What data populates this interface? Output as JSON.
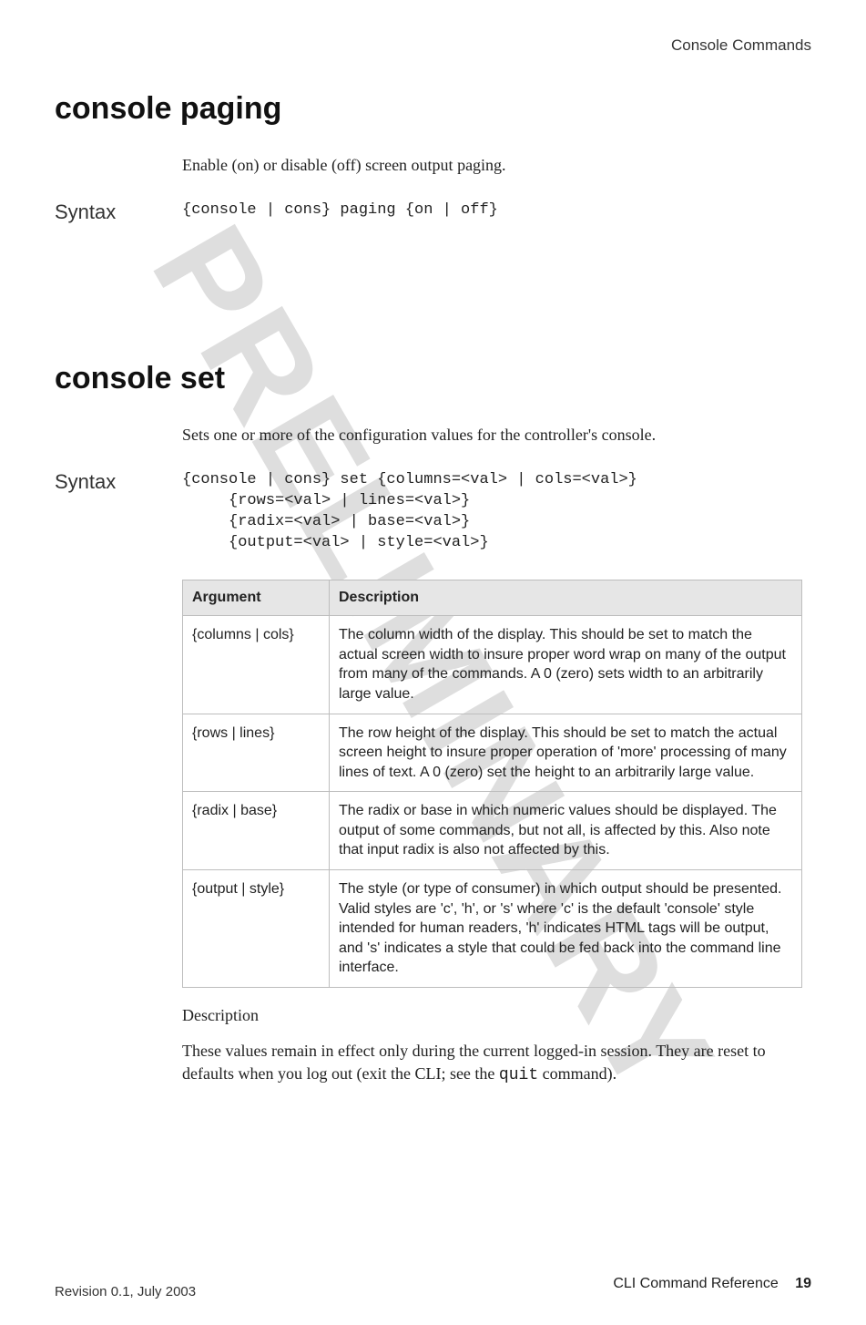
{
  "watermark": "PRELIMINARY",
  "header": {
    "section": "Console Commands"
  },
  "commands": [
    {
      "title": "console paging",
      "intro": "Enable (on) or disable (off) screen output paging.",
      "syntax_label": "Syntax",
      "syntax": "{console | cons} paging {on | off}"
    },
    {
      "title": "console set",
      "intro": "Sets one or more of the configuration values for the controller's console.",
      "syntax_label": "Syntax",
      "syntax": "{console | cons} set {columns=<val> | cols=<val>}\n     {rows=<val> | lines=<val>}\n     {radix=<val> | base=<val>}\n     {output=<val> | style=<val>}",
      "table": {
        "headers": {
          "arg": "Argument",
          "desc": "Description"
        },
        "rows": [
          {
            "arg": "{columns | cols}",
            "desc": "The column width of the display. This should be set to match the actual screen width to insure proper word wrap on many of the output from many of the commands. A 0 (zero) sets width to an arbitrarily large value."
          },
          {
            "arg": "{rows | lines}",
            "desc": "The row height of the display. This should be set to match the actual screen height to insure proper operation of 'more' processing of many lines of text. A 0 (zero) set the height to an arbitrarily large value."
          },
          {
            "arg": "{radix | base}",
            "desc": "The radix or base in which numeric values should be displayed. The output of some commands, but not all, is affected by this. Also note that input radix is also not affected by this."
          },
          {
            "arg": "{output | style}",
            "desc": "The style (or type of consumer) in which output should be presented. Valid styles are 'c', 'h', or 's' where 'c' is the default 'console' style intended for human readers, 'h' indicates HTML tags will be output, and 's' indicates a style that could be fed back into the command line interface."
          }
        ]
      },
      "post": {
        "head": "Description",
        "body_pre": "These values remain in effect only during the current logged-in session. They are reset to defaults when you log out (exit the CLI; see the ",
        "body_mono": "quit",
        "body_post": " command)."
      }
    }
  ],
  "footer": {
    "left": "Revision 0.1, July 2003",
    "right_label": "CLI Command Reference",
    "page": "19"
  }
}
